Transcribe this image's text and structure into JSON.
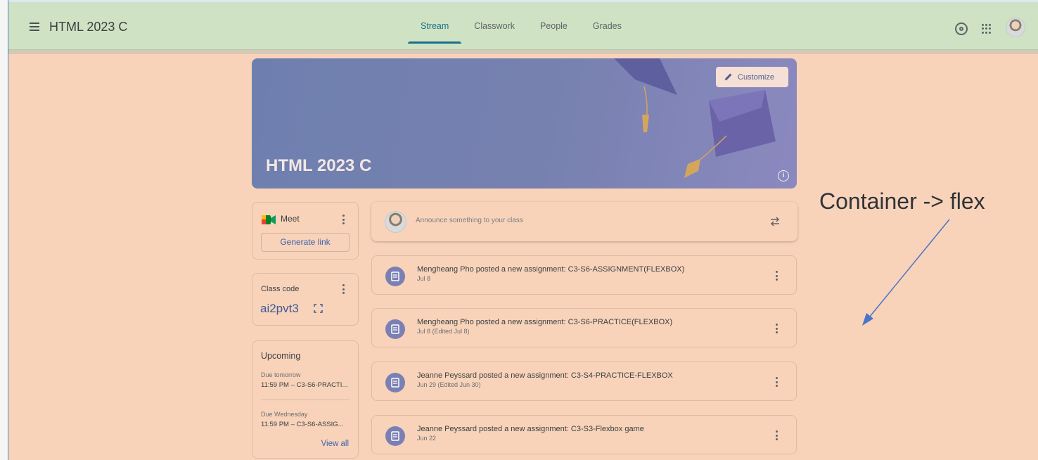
{
  "header": {
    "app_title": "HTML 2023 C",
    "tabs": [
      {
        "label": "Stream",
        "active": true
      },
      {
        "label": "Classwork",
        "active": false
      },
      {
        "label": "People",
        "active": false
      },
      {
        "label": "Grades",
        "active": false
      }
    ]
  },
  "banner": {
    "title": "HTML 2023 C",
    "customize_label": "Customize"
  },
  "meet": {
    "label": "Meet",
    "button_label": "Generate link"
  },
  "class_code": {
    "label": "Class code",
    "value": "ai2pvt3"
  },
  "upcoming": {
    "title": "Upcoming",
    "items": [
      {
        "due": "Due tomorrow",
        "detail": "11:59 PM – C3-S6-PRACTI..."
      },
      {
        "due": "Due Wednesday",
        "detail": "11:59 PM – C3-S6-ASSIG..."
      }
    ],
    "view_all_label": "View all"
  },
  "announce": {
    "placeholder": "Announce something to your class"
  },
  "posts": [
    {
      "title": "Mengheang Pho posted a new assignment: C3-S6-ASSIGNMENT(FLEXBOX)",
      "date": "Jul 8"
    },
    {
      "title": "Mengheang Pho posted a new assignment: C3-S6-PRACTICE(FLEXBOX)",
      "date": "Jul 8 (Edited Jul 8)"
    },
    {
      "title": "Jeanne Peyssard posted a new assignment: C3-S4-PRACTICE-FLEXBOX",
      "date": "Jun 29 (Edited Jun 30)"
    },
    {
      "title": "Jeanne Peyssard posted a new assignment: C3-S3-Flexbox game",
      "date": "Jun 22"
    }
  ],
  "annotation": {
    "text": "Container -> flex"
  },
  "colors": {
    "page_background": "#f8d3b9",
    "topbar_background": "#cfe3c4",
    "banner_background": "#7781b0",
    "accent": "#1a6e8b",
    "link": "#3b64b2",
    "annotation_arrow": "#4a74c9"
  }
}
